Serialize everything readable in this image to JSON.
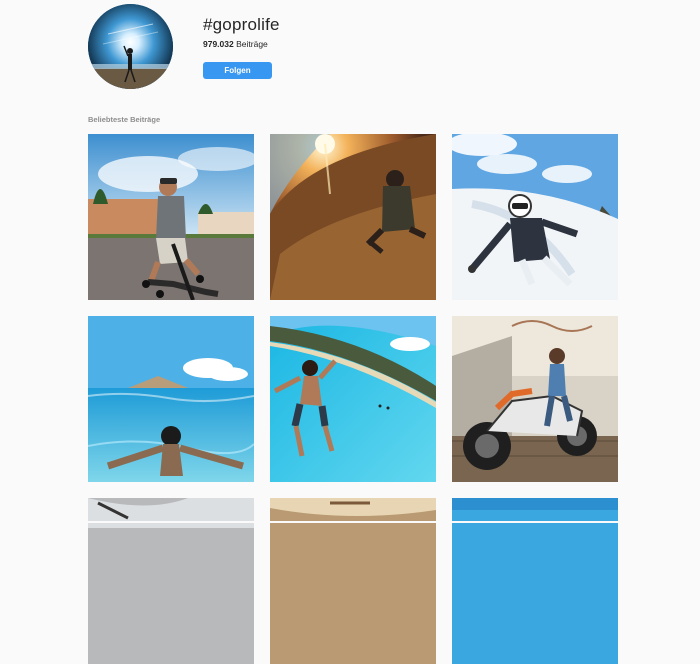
{
  "tag": {
    "title": "#goprolife",
    "post_count": "979.032",
    "post_count_label": "Beiträge"
  },
  "follow_button": "Folgen",
  "section_label": "Beliebteste Beiträge",
  "posts": [
    "skateboarder-post",
    "hill-sunset-post",
    "snow-angel-post",
    "underwater-snorkel-post",
    "cliff-jump-post",
    "motorcycle-post",
    "partial-post-1",
    "partial-post-2",
    "partial-post-3"
  ],
  "colors": {
    "accent": "#3897f0",
    "background": "#fafafa",
    "text": "#262626",
    "muted": "#8e8e8e"
  }
}
